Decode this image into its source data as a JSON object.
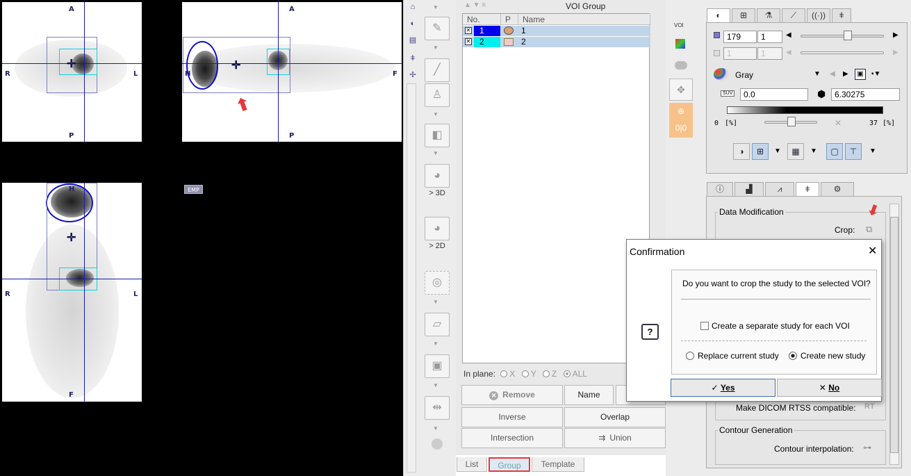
{
  "viewer": {
    "views": [
      {
        "top": "A",
        "bottom": "P",
        "left": "R",
        "right": "L"
      },
      {
        "top": "A",
        "bottom": "P",
        "left": "H",
        "right": "F"
      },
      {
        "top": "H",
        "bottom": "F",
        "left": "R",
        "right": "L"
      }
    ],
    "emp_label": "EMP"
  },
  "toolbar": {
    "label_3d": "> 3D",
    "label_2d": "> 2D"
  },
  "voi": {
    "title": "VOI Group",
    "columns": {
      "no": "No.",
      "p": "P",
      "name": "Name"
    },
    "rows": [
      {
        "no": "1",
        "name": "1",
        "color": "#0000ee"
      },
      {
        "no": "2",
        "name": "2",
        "color": "#00eeee"
      }
    ],
    "inplane_label": "In plane:",
    "radio_options": [
      "X",
      "Y",
      "Z",
      "ALL"
    ],
    "buttons": {
      "remove": "Remove",
      "name": "Name",
      "inverse": "Inverse",
      "overlap": "Overlap",
      "intersection": "Intersection",
      "union": "Union"
    },
    "bottom_tabs": [
      "List",
      "Group",
      "Template"
    ],
    "active_tab": "Group",
    "side_voi_label": "VOI"
  },
  "controls": {
    "frame_value": "179",
    "frame_step": "1",
    "frame_value2": "1",
    "frame_step2": "1",
    "colormap": "Gray",
    "suv_label": "SUV",
    "min_value": "0.0",
    "max_value": "6.30275",
    "pct_left": "0",
    "pct_unit": "[%]",
    "pct_right": "37",
    "pct_unit_right": "[%]"
  },
  "settings": {
    "section_data": "Data Modification",
    "crop_label": "Crop:",
    "rtss_label": "Make DICOM RTSS compatible:",
    "rtss_icon": "RT",
    "section_contour": "Contour Generation",
    "interp_label": "Contour interpolation:"
  },
  "dialog": {
    "title": "Confirmation",
    "question": "Do you want to crop the study to the selected VOI?",
    "checkbox_label": "Create a separate study for each VOI",
    "radio_replace": "Replace current study",
    "radio_create": "Create new study",
    "yes": "Yes",
    "no": "No",
    "help_icon": "?"
  },
  "colors": {
    "highlight": "#e23b3b",
    "crosshair": "#1a1aaa",
    "voi_cyan": "#10d0e0",
    "selected_row": "#c0d4ea"
  }
}
